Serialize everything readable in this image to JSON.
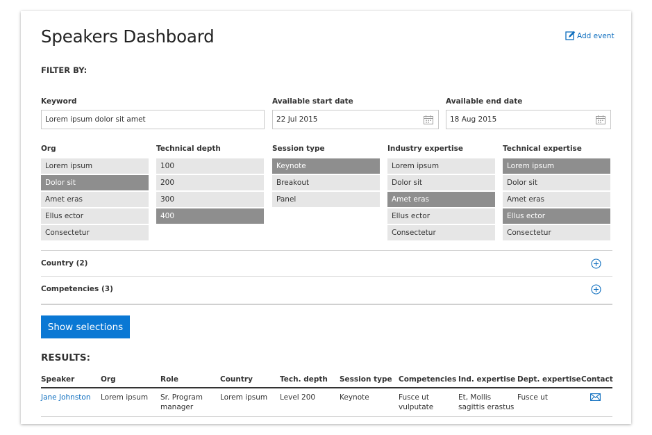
{
  "header": {
    "title": "Speakers Dashboard",
    "add_event_label": "Add event"
  },
  "filter": {
    "heading": "FILTER BY:",
    "keyword": {
      "label": "Keyword",
      "value": "Lorem ipsum dolor sit amet"
    },
    "start_date": {
      "label": "Available start date",
      "value": "22 Jul 2015"
    },
    "end_date": {
      "label": "Available end date",
      "value": "18 Aug 2015"
    },
    "lists": [
      {
        "label": "Org",
        "options": [
          {
            "text": "Lorem ipsum",
            "selected": false
          },
          {
            "text": "Dolor sit",
            "selected": true
          },
          {
            "text": "Amet eras",
            "selected": false
          },
          {
            "text": "Ellus ector",
            "selected": false
          },
          {
            "text": "Consectetur",
            "selected": false
          }
        ]
      },
      {
        "label": "Technical depth",
        "options": [
          {
            "text": "100",
            "selected": false
          },
          {
            "text": "200",
            "selected": false
          },
          {
            "text": "300",
            "selected": false
          },
          {
            "text": "400",
            "selected": true
          }
        ]
      },
      {
        "label": "Session type",
        "options": [
          {
            "text": "Keynote",
            "selected": true
          },
          {
            "text": "Breakout",
            "selected": false
          },
          {
            "text": "Panel",
            "selected": false
          }
        ]
      },
      {
        "label": "Industry expertise",
        "options": [
          {
            "text": "Lorem ipsum",
            "selected": false
          },
          {
            "text": "Dolor sit",
            "selected": false
          },
          {
            "text": "Amet eras",
            "selected": true
          },
          {
            "text": "Ellus ector",
            "selected": false
          },
          {
            "text": "Consectetur",
            "selected": false
          }
        ]
      },
      {
        "label": "Technical expertise",
        "options": [
          {
            "text": "Lorem ipsum",
            "selected": true
          },
          {
            "text": "Dolor sit",
            "selected": false
          },
          {
            "text": "Amet eras",
            "selected": false
          },
          {
            "text": "Ellus ector",
            "selected": true
          },
          {
            "text": "Consectetur",
            "selected": false
          }
        ]
      }
    ],
    "accordions": [
      {
        "label": "Country (2)"
      },
      {
        "label": "Competencies (3)"
      }
    ],
    "show_button_label": "Show selections"
  },
  "results": {
    "heading": "RESULTS:",
    "columns": [
      "Speaker",
      "Org",
      "Role",
      "Country",
      "Tech. depth",
      "Session type",
      "Competencies",
      "Ind. expertise",
      "Dept. expertise",
      "Contact"
    ],
    "rows": [
      {
        "speaker": "Jane Johnston",
        "org": "Lorem ipsum",
        "role_line1": "Sr. Program",
        "role_line2": "manager",
        "country": "Lorem ipsum",
        "tech_depth": "Level 200",
        "session_type": "Keynote",
        "competencies_line1": "Fusce ut",
        "competencies_line2": "vulputate",
        "ind_expertise_line1": "Et, Mollis",
        "ind_expertise_line2": "sagittis erastus",
        "dept_expertise": "Fusce ut",
        "contact_icon": "mail-icon"
      }
    ]
  },
  "colors": {
    "accent": "#0a78d4",
    "link": "#0a6cbe",
    "selected_option": "#8e8e8e",
    "option": "#e6e6e6"
  }
}
